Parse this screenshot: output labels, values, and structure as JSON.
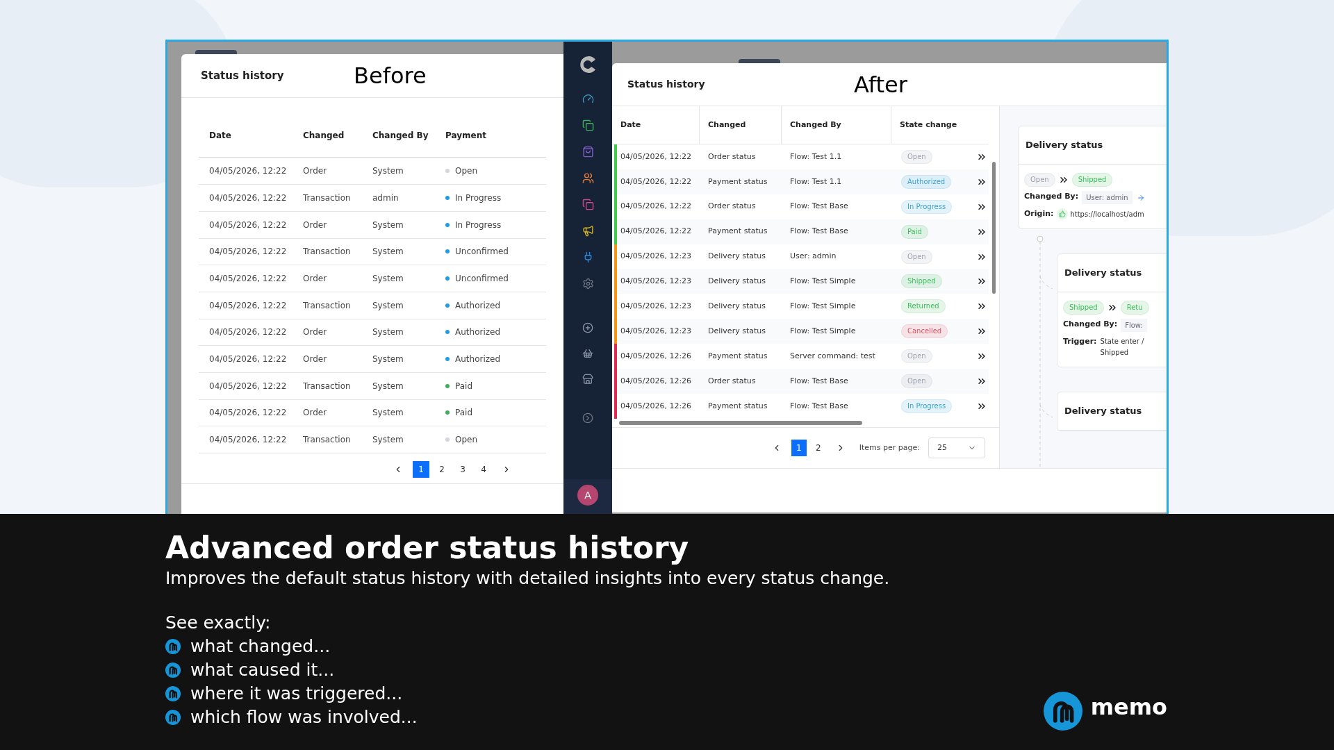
{
  "before": {
    "title": "Status history",
    "caption": "Before",
    "columns": [
      "Date",
      "Changed",
      "Changed By",
      "Payment"
    ],
    "rows": [
      {
        "date": "04/05/2026, 12:22",
        "changed": "Order",
        "changed_by": "System",
        "payment": "Open",
        "color": "#d1d5db"
      },
      {
        "date": "04/05/2026, 12:22",
        "changed": "Transaction",
        "changed_by": "admin",
        "payment": "In Progress",
        "color": "#1e9be9"
      },
      {
        "date": "04/05/2026, 12:22",
        "changed": "Order",
        "changed_by": "System",
        "payment": "In Progress",
        "color": "#1e9be9"
      },
      {
        "date": "04/05/2026, 12:22",
        "changed": "Transaction",
        "changed_by": "System",
        "payment": "Unconfirmed",
        "color": "#1e9be9"
      },
      {
        "date": "04/05/2026, 12:22",
        "changed": "Order",
        "changed_by": "System",
        "payment": "Unconfirmed",
        "color": "#1e9be9"
      },
      {
        "date": "04/05/2026, 12:22",
        "changed": "Transaction",
        "changed_by": "System",
        "payment": "Authorized",
        "color": "#1e9be9"
      },
      {
        "date": "04/05/2026, 12:22",
        "changed": "Order",
        "changed_by": "System",
        "payment": "Authorized",
        "color": "#1e9be9"
      },
      {
        "date": "04/05/2026, 12:22",
        "changed": "Order",
        "changed_by": "System",
        "payment": "Authorized",
        "color": "#1e9be9"
      },
      {
        "date": "04/05/2026, 12:22",
        "changed": "Transaction",
        "changed_by": "System",
        "payment": "Paid",
        "color": "#3fae5a"
      },
      {
        "date": "04/05/2026, 12:22",
        "changed": "Order",
        "changed_by": "System",
        "payment": "Paid",
        "color": "#3fae5a"
      },
      {
        "date": "04/05/2026, 12:22",
        "changed": "Transaction",
        "changed_by": "System",
        "payment": "Open",
        "color": "#d1d5db"
      }
    ],
    "pages": [
      {
        "label": "1",
        "selected": true
      },
      {
        "label": "2",
        "selected": false
      },
      {
        "label": "3",
        "selected": false
      },
      {
        "label": "4",
        "selected": false
      }
    ]
  },
  "sidebar": {
    "avatar": "A"
  },
  "after": {
    "title": "Status history",
    "caption": "After",
    "columns": [
      "Date",
      "Changed",
      "Changed By",
      "State change"
    ],
    "rows": [
      {
        "date": "04/05/2026, 12:22",
        "changed": "Order status",
        "changed_by": "Flow: Test 1.1",
        "state": {
          "label": "Open",
          "color": "#9ca3af"
        },
        "color": "#3ccb4a"
      },
      {
        "date": "04/05/2026, 12:22",
        "changed": "Payment status",
        "changed_by": "Flow: Test 1.1",
        "state": {
          "label": "Authorized",
          "color": "#38a3d6"
        },
        "color": "#3ccb4a"
      },
      {
        "date": "04/05/2026, 12:22",
        "changed": "Order status",
        "changed_by": "Flow: Test Base",
        "state": {
          "label": "In Progress",
          "color": "#38a3d6"
        },
        "color": "#3ccb4a"
      },
      {
        "date": "04/05/2026, 12:22",
        "changed": "Payment status",
        "changed_by": "Flow: Test Base",
        "state": {
          "label": "Paid",
          "color": "#3cbf5a"
        },
        "color": "#3ccb4a"
      },
      {
        "date": "04/05/2026, 12:23",
        "changed": "Delivery status",
        "changed_by": "User: admin",
        "state": {
          "label": "Open",
          "color": "#9ca3af"
        },
        "color": "#f7960e"
      },
      {
        "date": "04/05/2026, 12:23",
        "changed": "Delivery status",
        "changed_by": "Flow: Test Simple",
        "state": {
          "label": "Shipped",
          "color": "#3cbf5a"
        },
        "color": "#f7960e"
      },
      {
        "date": "04/05/2026, 12:23",
        "changed": "Delivery status",
        "changed_by": "Flow: Test Simple",
        "state": {
          "label": "Returned",
          "color": "#3cbf5a"
        },
        "color": "#f7960e"
      },
      {
        "date": "04/05/2026, 12:23",
        "changed": "Delivery status",
        "changed_by": "Flow: Test Simple",
        "state": {
          "label": "Cancelled",
          "color": "#e25563"
        },
        "color": "#f7960e"
      },
      {
        "date": "04/05/2026, 12:26",
        "changed": "Payment status",
        "changed_by": "Server command: test",
        "state": {
          "label": "Open",
          "color": "#9ca3af"
        },
        "color": "#e0294f"
      },
      {
        "date": "04/05/2026, 12:26",
        "changed": "Order status",
        "changed_by": "Flow: Test Base",
        "state": {
          "label": "Open",
          "color": "#9ca3af"
        },
        "color": "#e0294f"
      },
      {
        "date": "04/05/2026, 12:26",
        "changed": "Payment status",
        "changed_by": "Flow: Test Base",
        "state": {
          "label": "In Progress",
          "color": "#38a3d6"
        },
        "color": "#e0294f"
      }
    ],
    "pages": [
      {
        "label": "1",
        "selected": true
      },
      {
        "label": "2",
        "selected": false
      }
    ],
    "items_per_page": {
      "label": "Items per page:",
      "value": "25"
    },
    "cards": [
      {
        "title": "Delivery status",
        "from": {
          "label": "Open",
          "color": "#9ca3af"
        },
        "to": {
          "label": "Shipped",
          "color": "#3cbf5a"
        },
        "fields": [
          {
            "label": "Changed By:",
            "value": "User: admin",
            "kind": "chip-link"
          },
          {
            "label": "Origin:",
            "value": "https://localhost/adm",
            "kind": "url"
          }
        ]
      },
      {
        "title": "Delivery status",
        "from": {
          "label": "Shipped",
          "color": "#3cbf5a"
        },
        "to": {
          "label": "Retu",
          "color": "#3cbf5a"
        },
        "fields": [
          {
            "label": "Changed By:",
            "value": "Flow:",
            "kind": "chip"
          },
          {
            "label": "Trigger:",
            "value": "State enter / Shipped",
            "kind": "text"
          }
        ]
      },
      {
        "title": "Delivery status"
      }
    ]
  },
  "promo": {
    "heading": "Advanced order status history",
    "subtitle": "Improves the default status history with detailed insights into every status change.",
    "lead": "See exactly:",
    "bullets": [
      "what changed...",
      "what caused it...",
      "where it was triggered...",
      "which flow was involved..."
    ],
    "brand": "memo"
  }
}
